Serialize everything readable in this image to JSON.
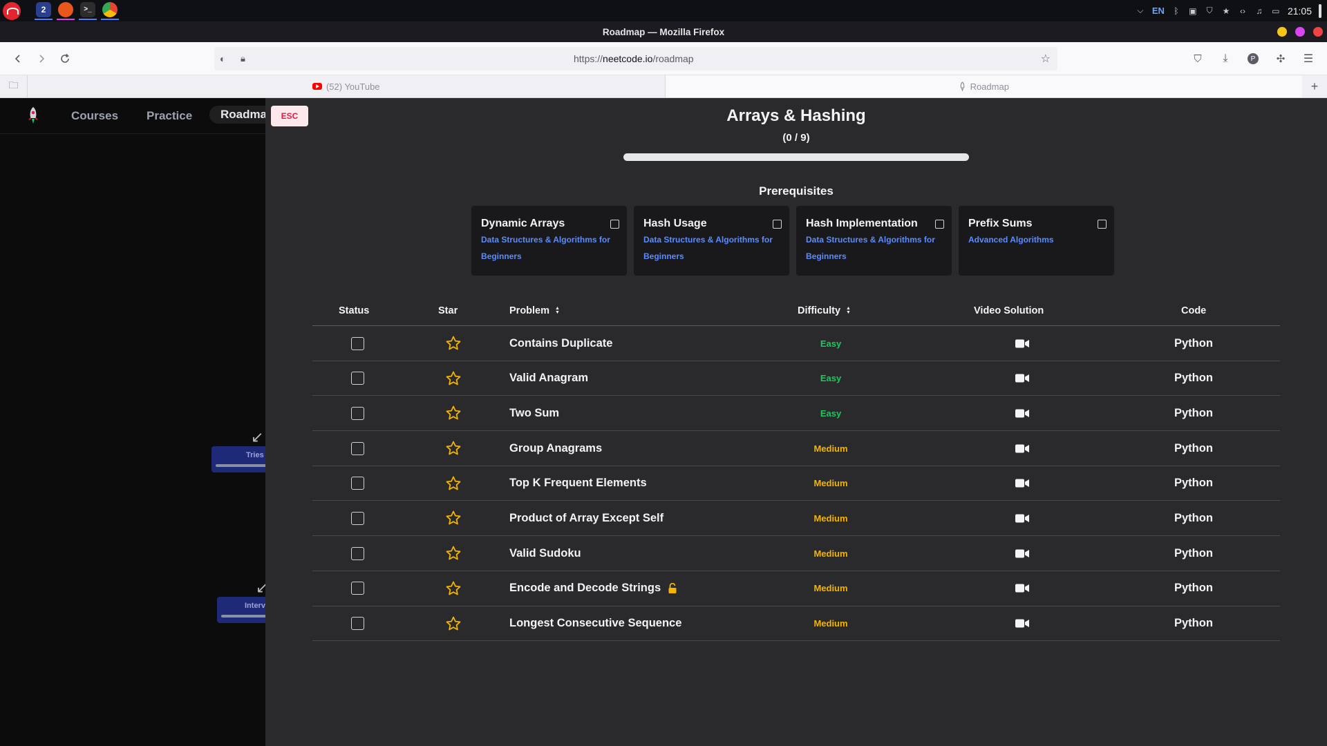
{
  "os": {
    "workspace_badge": "2",
    "language": "EN",
    "clock": "21:05"
  },
  "browser": {
    "window_title": "Roadmap — Mozilla Firefox",
    "url_prefix": "https://",
    "url_domain": "neetcode.io",
    "url_path": "/roadmap",
    "tabs": [
      {
        "label": "(52) YouTube",
        "icon": "youtube-icon",
        "active": false
      },
      {
        "label": "Roadmap",
        "icon": "rocket-icon",
        "active": true
      }
    ]
  },
  "site_nav": {
    "links": [
      "Courses",
      "Practice",
      "Roadma"
    ]
  },
  "map_nodes": {
    "tries": "Tries",
    "intervals": "Interv"
  },
  "drawer": {
    "esc_label": "ESC",
    "title": "Arrays & Hashing",
    "progress_text": "(0 / 9)",
    "progress_fraction": 0,
    "prereq_heading": "Prerequisites",
    "prerequisites": [
      {
        "name": "Dynamic Arrays",
        "course": "Data Structures & Algorithms for Beginners"
      },
      {
        "name": "Hash Usage",
        "course": "Data Structures & Algorithms for Beginners"
      },
      {
        "name": "Hash Implementation",
        "course": "Data Structures & Algorithms for Beginners"
      },
      {
        "name": "Prefix Sums",
        "course": "Advanced Algorithms"
      }
    ],
    "table": {
      "headers": {
        "status": "Status",
        "star": "Star",
        "problem": "Problem",
        "difficulty": "Difficulty",
        "video": "Video Solution",
        "code": "Code"
      },
      "rows": [
        {
          "problem": "Contains Duplicate",
          "difficulty": "Easy",
          "code": "Python",
          "locked": false
        },
        {
          "problem": "Valid Anagram",
          "difficulty": "Easy",
          "code": "Python",
          "locked": false
        },
        {
          "problem": "Two Sum",
          "difficulty": "Easy",
          "code": "Python",
          "locked": false
        },
        {
          "problem": "Group Anagrams",
          "difficulty": "Medium",
          "code": "Python",
          "locked": false
        },
        {
          "problem": "Top K Frequent Elements",
          "difficulty": "Medium",
          "code": "Python",
          "locked": false
        },
        {
          "problem": "Product of Array Except Self",
          "difficulty": "Medium",
          "code": "Python",
          "locked": false
        },
        {
          "problem": "Valid Sudoku",
          "difficulty": "Medium",
          "code": "Python",
          "locked": false
        },
        {
          "problem": "Encode and Decode Strings",
          "difficulty": "Medium",
          "code": "Python",
          "locked": true
        },
        {
          "problem": "Longest Consecutive Sequence",
          "difficulty": "Medium",
          "code": "Python",
          "locked": false
        }
      ]
    }
  },
  "colors": {
    "easy": "#22c55e",
    "medium": "#f5b400",
    "star": "#f5b400",
    "link": "#5b8cff",
    "drawer_bg": "#2a2a2d"
  }
}
